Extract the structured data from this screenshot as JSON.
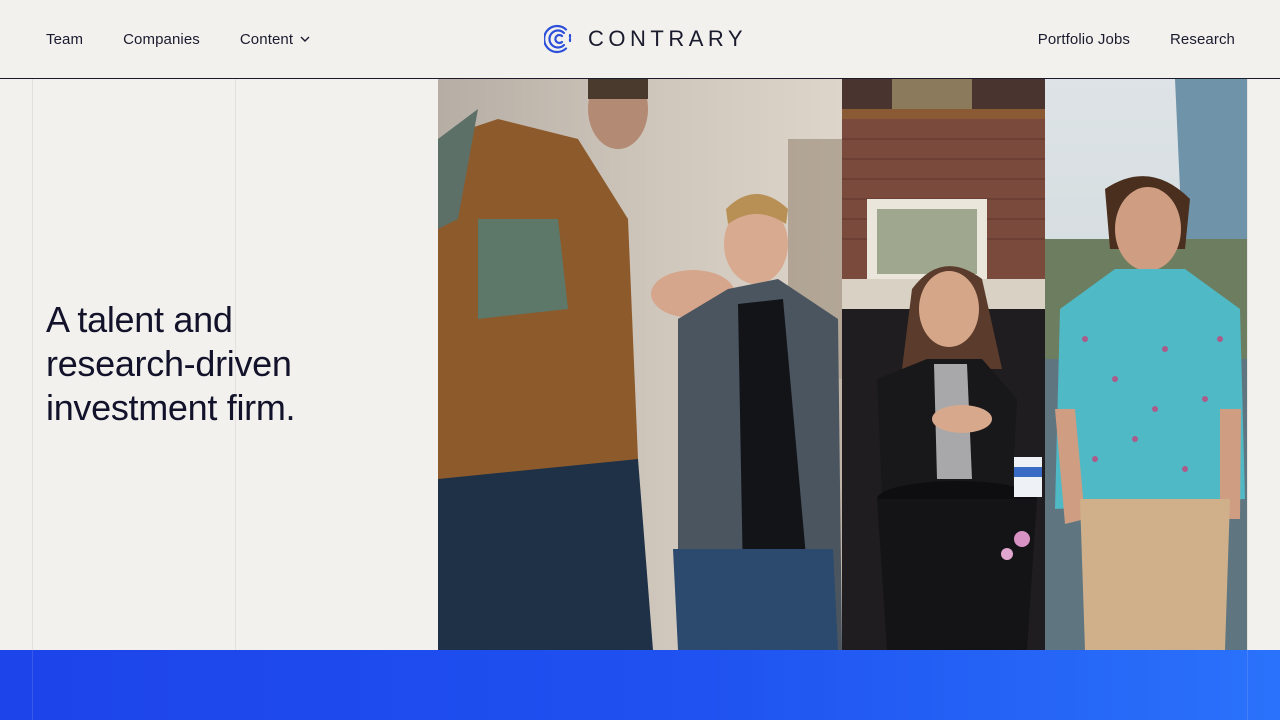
{
  "nav": {
    "left": [
      {
        "label": "Team"
      },
      {
        "label": "Companies"
      },
      {
        "label": "Content"
      }
    ],
    "right": [
      {
        "label": "Portfolio Jobs"
      },
      {
        "label": "Research"
      }
    ]
  },
  "logo": {
    "text": "CONTRARY",
    "icon": "contrary-logo-icon",
    "color": "#2b4fd9"
  },
  "hero": {
    "title": "A talent and research-driven investment firm.",
    "photos": [
      {
        "alt": "two-men-talking-photo"
      },
      {
        "alt": "woman-at-cafe-table-photo"
      },
      {
        "alt": "man-in-floral-shirt-photo"
      }
    ]
  },
  "colors": {
    "background": "#f2f1ee",
    "text": "#12122a",
    "band_start": "#1d43ea",
    "band_end": "#2a72fb"
  }
}
